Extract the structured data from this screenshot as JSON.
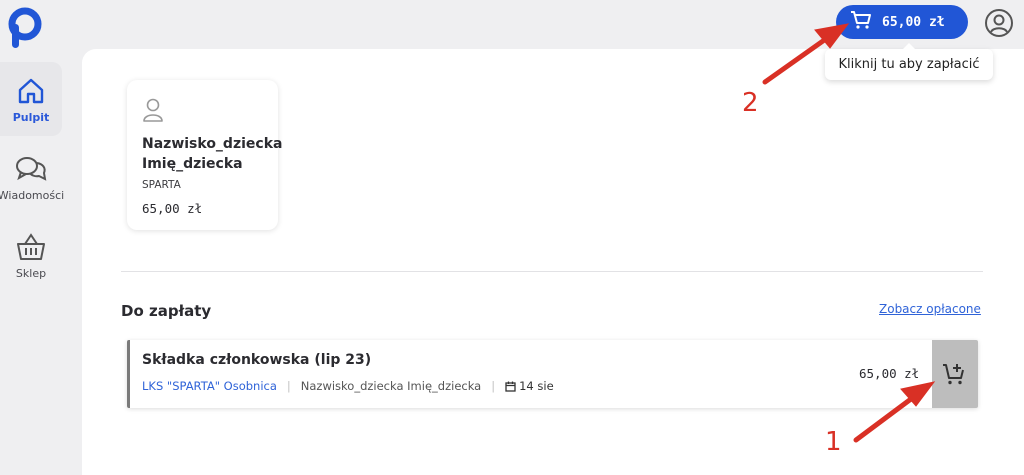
{
  "sidebar": {
    "items": [
      {
        "label": "Pulpit",
        "icon": "home-icon",
        "active": true
      },
      {
        "label": "Wiadomości",
        "icon": "chat-icon",
        "active": false
      },
      {
        "label": "Sklep",
        "icon": "basket-icon",
        "active": false
      }
    ]
  },
  "header": {
    "cart_total": "65,00 zł",
    "tooltip": "Kliknij tu aby zapłacić"
  },
  "child_card": {
    "name_line1": "Nazwisko_dziecka",
    "name_line2": "Imię_dziecka",
    "club": "SPARTA",
    "amount": "65,00 zł"
  },
  "payments": {
    "section_title": "Do zapłaty",
    "see_paid_link": "Zobacz opłacone",
    "items": [
      {
        "title": "Składka członkowska (lip 23)",
        "club": "LKS \"SPARTA\" Osobnica",
        "child": "Nazwisko_dziecka Imię_dziecka",
        "date": "14 sie",
        "amount": "65,00 zł"
      }
    ]
  },
  "annotations": {
    "label_1": "1",
    "label_2": "2",
    "color": "#d93025"
  },
  "colors": {
    "accent": "#2156d6",
    "link": "#2f63d8"
  }
}
